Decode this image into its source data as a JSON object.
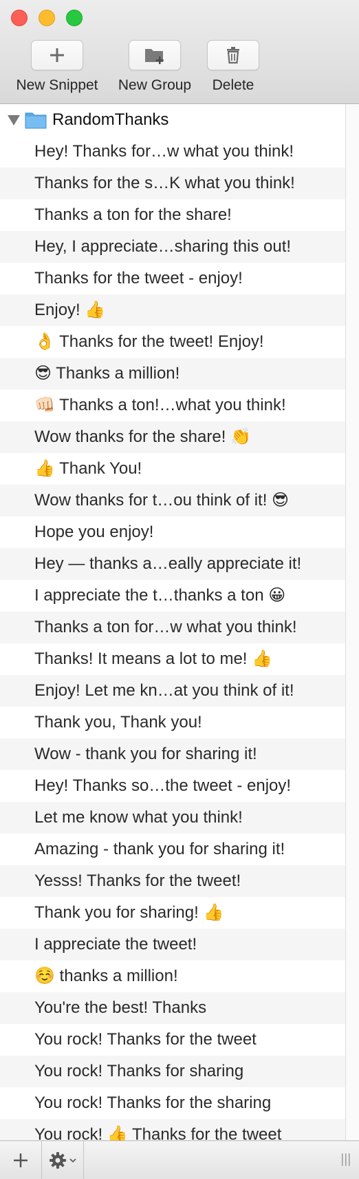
{
  "window": {
    "controls": [
      "close",
      "minimize",
      "zoom"
    ]
  },
  "toolbar": {
    "new_snippet": {
      "label": "New Snippet",
      "icon": "plus-icon"
    },
    "new_group": {
      "label": "New Group",
      "icon": "folder-plus-icon"
    },
    "delete": {
      "label": "Delete",
      "icon": "trash-icon"
    }
  },
  "outline": {
    "group": {
      "name": "RandomThanks",
      "expanded": true,
      "icon": "folder-icon"
    },
    "snippets": [
      "Hey! Thanks for…w what you think!",
      "Thanks for the s…K what you think!",
      "Thanks a ton for the share!",
      "Hey, I appreciate…sharing this out!",
      "Thanks for the tweet - enjoy!",
      "Enjoy! 👍",
      "👌 Thanks for the tweet! Enjoy!",
      "😎 Thanks a million!",
      "👊🏻 Thanks a ton!…what you think!",
      "Wow thanks for the share! 👏",
      "👍 Thank You!",
      "Wow thanks for t…ou think of it! 😎",
      "Hope you enjoy!",
      "Hey — thanks a…eally appreciate it!",
      "I appreciate the t…thanks a ton 😀",
      "Thanks a ton for…w what you think!",
      "Thanks! It means a lot to me! 👍",
      "Enjoy! Let me kn…at you think of it!",
      "Thank you, Thank you!",
      "Wow - thank you for sharing it!",
      "Hey! Thanks so…the tweet - enjoy!",
      "Let me know what you think!",
      "Amazing - thank you for sharing it!",
      "Yesss! Thanks for the tweet!",
      "Thank you for sharing! 👍",
      "I appreciate the tweet!",
      "☺️ thanks a million!",
      "You're the best! Thanks",
      "You rock! Thanks for the tweet",
      "You rock! Thanks for sharing",
      "You rock! Thanks for the sharing",
      "You rock! 👍 Thanks for the tweet"
    ]
  },
  "bottombar": {
    "add_icon": "plus-icon",
    "action_icon": "gear-icon",
    "chevron_icon": "chevron-down-icon",
    "resize_icon": "resize-grip-icon"
  },
  "colors": {
    "close": "#fc5f57",
    "minimize": "#fdbc2e",
    "zoom": "#28c840",
    "row_alt": "#f5f5f5",
    "folder": "#5aa9e6"
  }
}
